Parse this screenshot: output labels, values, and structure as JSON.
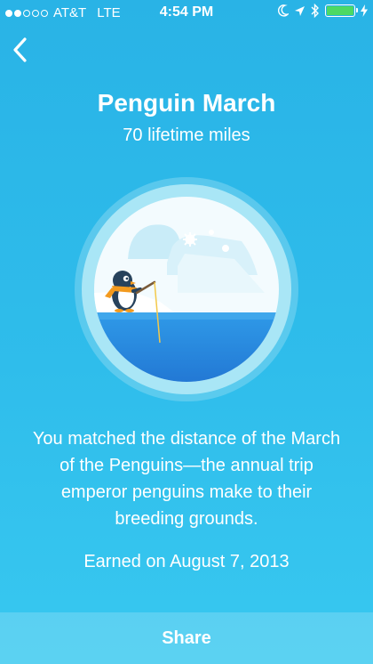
{
  "status_bar": {
    "carrier": "AT&T",
    "network": "LTE",
    "time": "4:54 PM",
    "signal_bars_filled": 2,
    "signal_bars_total": 5,
    "battery_level": 1.0,
    "icons": [
      "moon-icon",
      "location-arrow-icon",
      "bluetooth-icon",
      "battery-icon",
      "charging-icon"
    ]
  },
  "nav": {
    "back_icon": "chevron-left-icon"
  },
  "badge": {
    "title": "Penguin March",
    "subtitle": "70 lifetime miles",
    "illustration": "penguin-fishing-badge"
  },
  "description": "You matched the distance of the March of the Penguins—the annual trip emperor penguins make to their breeding grounds.",
  "earned": "Earned on August 7, 2013",
  "share_label": "Share",
  "colors": {
    "background": "#2fbdeb",
    "badge_outer": "#a8e4f5",
    "water": "#2a8de0",
    "scarf": "#f39a1e",
    "battery": "#4cd964"
  }
}
